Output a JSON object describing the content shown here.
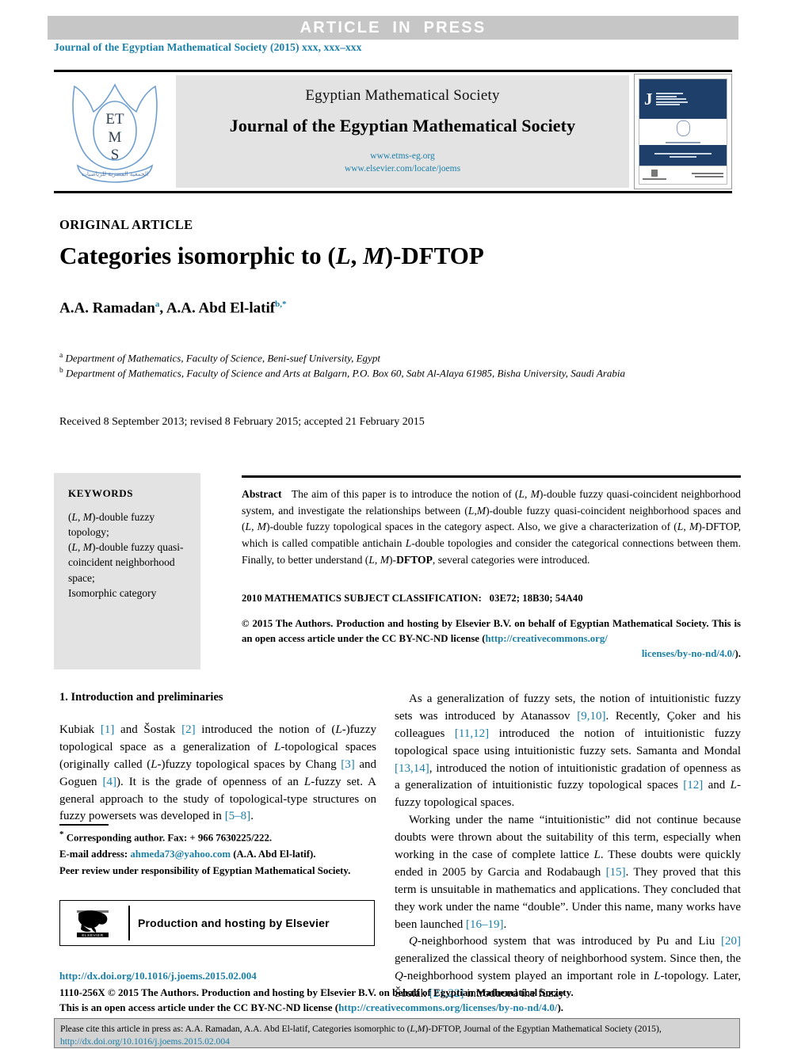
{
  "header": {
    "article_in_press": "ARTICLE IN PRESS",
    "running_head": "Journal of the Egyptian Mathematical Society (2015) xxx, xxx–xxx"
  },
  "masthead": {
    "logo_text_lines": [
      "ET",
      "M",
      "S"
    ],
    "society_name": "Egyptian Mathematical Society",
    "journal_name": "Journal of the Egyptian Mathematical Society",
    "url_society": "www.etms-eg.org",
    "url_elsevier": "www.elsevier.com/locate/joems",
    "cover_initial": "J",
    "cover_title": "JOURNAL OF THE EGYPTIAN MATHEMATICAL SOCIETY"
  },
  "article": {
    "kind": "ORIGINAL ARTICLE",
    "title_prefix": "Categories isomorphic to (",
    "title_L": "L",
    "title_comma": ", ",
    "title_M": "M",
    "title_suffix": ")-DFTOP",
    "authors_1": "A.A. Ramadan",
    "authors_1_sup": "a",
    "authors_sep": ", ",
    "authors_2": "A.A. Abd El-latif",
    "authors_2_sup": "b,",
    "authors_2_star": "*",
    "affiliation_a_marker": "a",
    "affiliation_a": "Department of Mathematics, Faculty of Science, Beni-suef University, Egypt",
    "affiliation_b_marker": "b",
    "affiliation_b": "Department of Mathematics, Faculty of Science and Arts at Balgarn, P.O. Box 60, Sabt Al-Alaya 61985, Bisha University, Saudi Arabia",
    "history": "Received 8 September 2013; revised 8 February 2015; accepted 21 February 2015"
  },
  "keywords": {
    "title": "KEYWORDS",
    "items": [
      "(L, M)-double fuzzy topology;",
      "(L, M)-double fuzzy quasi-coincident neighborhood space;",
      "Isomorphic category"
    ]
  },
  "abstract": {
    "label": "Abstract",
    "text": "The aim of this paper is to introduce the notion of (L, M)-double fuzzy quasi-coincident neighborhood system, and investigate the relationships between (L, M)-double fuzzy quasi-coincident neighborhood spaces and (L, M)-double fuzzy topological spaces in the category aspect. Also, we give a characterization of (L, M)-DFTOP, which is called compatible antichain L-double topologies and consider the categorical connections between them. Finally, to better understand (L, M)-DFTOP, several categories were introduced."
  },
  "msc": {
    "label": "2010 MATHEMATICS SUBJECT CLASSIFICATION:",
    "codes": "03E72; 18B30; 54A40"
  },
  "copyright": {
    "line1": "© 2015 The Authors. Production and hosting by Elsevier B.V. on behalf of Egyptian Mathematical",
    "line2_a": "Society.  This is an open access article under the CC BY-NC-ND license (",
    "link_a": "http://creativecommons.org/",
    "link_b": "licenses/by-no-nd/4.0/",
    "line2_b": ")."
  },
  "body": {
    "section_heading": "1. Introduction and preliminaries",
    "left_paragraph_1": "Kubiak [1] and Šostak [2] introduced the notion of (L-)fuzzy topological space as a generalization of L-topological spaces (originally called (L-)fuzzy topological spaces by Chang [3] and Goguen [4]). It is the grade of openness of an L-fuzzy set. A general approach to the study of topological-type structures on fuzzy powersets was developed in [5–8].",
    "right_paragraph_1": "As a generalization of fuzzy sets, the notion of intuitionistic fuzzy sets was introduced by Atanassov [9,10]. Recently, Çoker and his colleagues [11,12] introduced the notion of intuitionistic fuzzy topological space using intuitionistic fuzzy sets. Samanta and Mondal [13,14], introduced the notion of intuitionistic gradation of openness as a generalization of intuitionistic fuzzy topological spaces [12] and L-fuzzy topological spaces.",
    "right_paragraph_2": "Working under the name \"intuitionistic\" did not continue because doubts were thrown about the suitability of this term, especially when working in the case of complete lattice L. These doubts were quickly ended in 2005 by Garcia and Rodabaugh [15]. They proved that this term is unsuitable in mathematics and applications. They concluded that they work under the name \"double\". Under this name, many works have been launched [16–19].",
    "right_paragraph_3": "Q-neighborhood system that was introduced by Pu and Liu [20] generalized the classical theory of neighborhood system. Since then, the Q-neighborhood system played an important role in L-topology. Later, Šostak [21,22] introduced the fuzzy"
  },
  "footnote": {
    "star": "*",
    "corresponding": "Corresponding author. Fax: + 966 7630225/222.",
    "email_label": "E-mail address:",
    "email": "ahmeda73@yahoo.com",
    "email_author": "(A.A. Abd El-latif).",
    "peer_review": "Peer review under responsibility of Egyptian Mathematical Society."
  },
  "production_box": {
    "logo_label": "ELSEVIER",
    "text": "Production and hosting by Elsevier"
  },
  "bottom": {
    "doi": "http://dx.doi.org/10.1016/j.joems.2015.02.004",
    "issn_line_1": "1110-256X © 2015 The Authors. Production and hosting by Elsevier B.V. on behalf of Egyptian Mathematical Society.",
    "issn_line_2_a": "This is an open access article under the CC BY-NC-ND license (",
    "issn_link": "http://creativecommons.org/licenses/by-no-nd/4.0/",
    "issn_line_2_b": ")."
  },
  "citation_box": {
    "text_a": "Please cite this article in press as: A.A. Ramadan, A.A. Abd El-latif, Categories isomorphic to (",
    "text_L": "L",
    "text_comma": ",",
    "text_M": "M",
    "text_b": ")-DFTOP,  Journal of the Egyptian Mathematical Society (2015),",
    "link": "http://dx.doi.org/10.1016/j.joems.2015.02.004"
  },
  "colors": {
    "accent_blue": "#1a7fa8",
    "bar_gray": "#c6c6c6",
    "panel_gray": "#e3e3e3",
    "cover_navy": "#1f3f6b"
  }
}
